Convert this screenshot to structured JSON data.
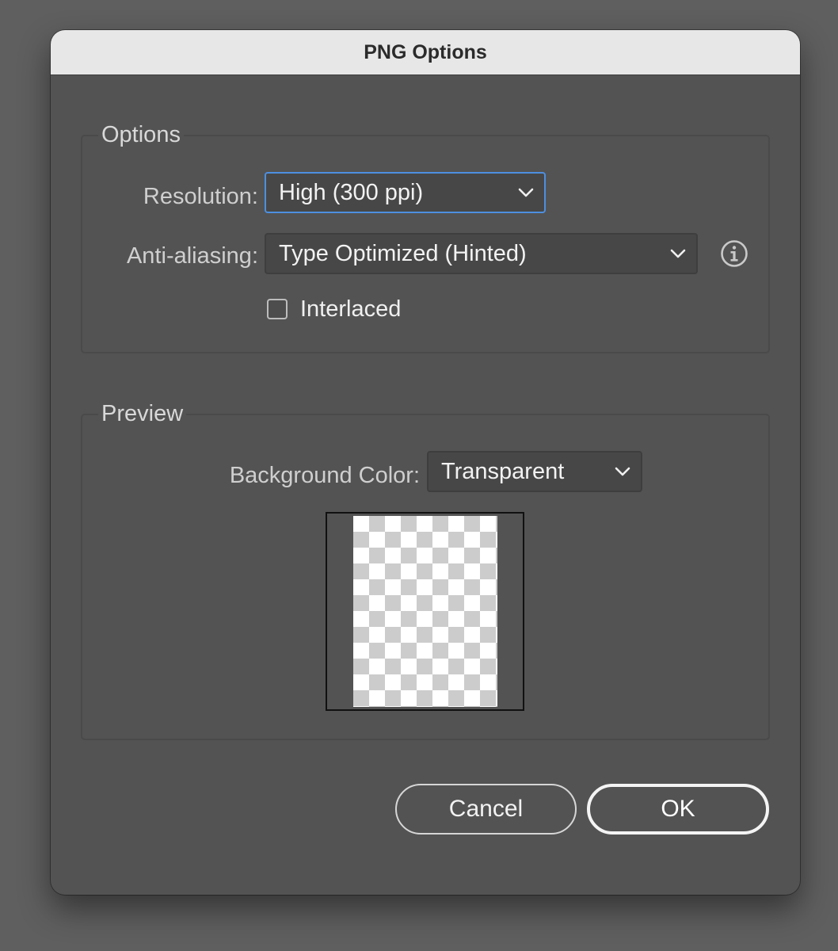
{
  "dialog": {
    "title": "PNG Options"
  },
  "options": {
    "legend": "Options",
    "resolution": {
      "label": "Resolution:",
      "value": "High (300 ppi)"
    },
    "anti_aliasing": {
      "label": "Anti-aliasing:",
      "value": "Type Optimized (Hinted)"
    },
    "interlaced": {
      "label": "Interlaced",
      "checked": false
    }
  },
  "preview": {
    "legend": "Preview",
    "background_color": {
      "label": "Background Color:",
      "value": "Transparent"
    }
  },
  "buttons": {
    "cancel_label": "Cancel",
    "ok_label": "OK"
  },
  "colors": {
    "dialog_bg": "#535353",
    "titlebar_bg": "#e7e7e7",
    "focus_ring": "#4d8fe0"
  },
  "icons": {
    "info": "info-circle-icon",
    "dropdown": "chevron-down-icon"
  }
}
